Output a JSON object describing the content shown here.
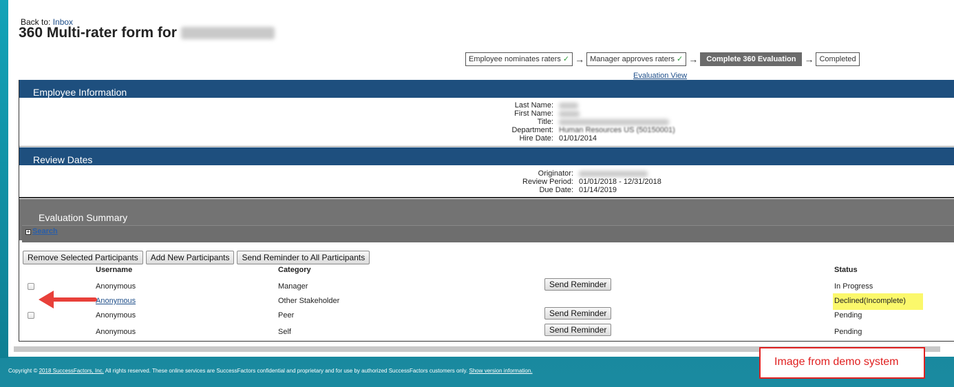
{
  "header": {
    "back_label": "Back to:",
    "back_link": "Inbox",
    "title": "360 Multi-rater form for"
  },
  "steps": [
    {
      "label": "Employee nominates raters",
      "check": "✓"
    },
    {
      "label": "Manager approves raters",
      "check": "✓"
    },
    {
      "label": "Complete 360 Evaluation"
    },
    {
      "label": "Completed"
    }
  ],
  "evaluation_view": "Evaluation View",
  "employee_info": {
    "heading": "Employee Information",
    "last_name_label": "Last Name:",
    "first_name_label": "First Name:",
    "title_label": "Title:",
    "department_label": "Department:",
    "department_value": "Human Resources US (50150001)",
    "hire_date_label": "Hire Date:",
    "hire_date_value": "01/01/2014"
  },
  "review_dates": {
    "heading": "Review Dates",
    "originator_label": "Originator:",
    "review_period_label": "Review Period:",
    "review_period_value": "01/01/2018 - 12/31/2018",
    "due_date_label": "Due Date:",
    "due_date_value": "01/14/2019"
  },
  "summary": {
    "heading": "Evaluation Summary",
    "search_label": "Search",
    "buttons": {
      "remove": "Remove Selected Participants",
      "add": "Add New Participants",
      "remind_all": "Send Reminder to All Participants"
    },
    "columns": {
      "username": "Username",
      "category": "Category",
      "status": "Status"
    },
    "rows": [
      {
        "username": "Anonymous",
        "category": "Manager",
        "reminder": "Send Reminder",
        "status": "In Progress"
      },
      {
        "username": "Anonymous",
        "category": "Other Stakeholder",
        "status": "Declined(Incomplete)"
      },
      {
        "username": "Anonymous",
        "category": "Peer",
        "reminder": "Send Reminder",
        "status": "Pending"
      },
      {
        "username": "Anonymous",
        "category": "Self",
        "reminder": "Send Reminder",
        "status": "Pending"
      }
    ]
  },
  "footer": {
    "copyright_prefix": "Copyright ©",
    "company_link": "2018 SuccessFactors, Inc.",
    "notice": "All rights reserved. These online services are SuccessFactors confidential and proprietary and for use by authorized SuccessFactors customers only.",
    "version_link": "Show version information."
  },
  "demo_note": "Image from demo system",
  "colors": {
    "section_header": "#1e4f7e",
    "highlight": "#fbf86b",
    "annotation_red": "#e02020"
  }
}
